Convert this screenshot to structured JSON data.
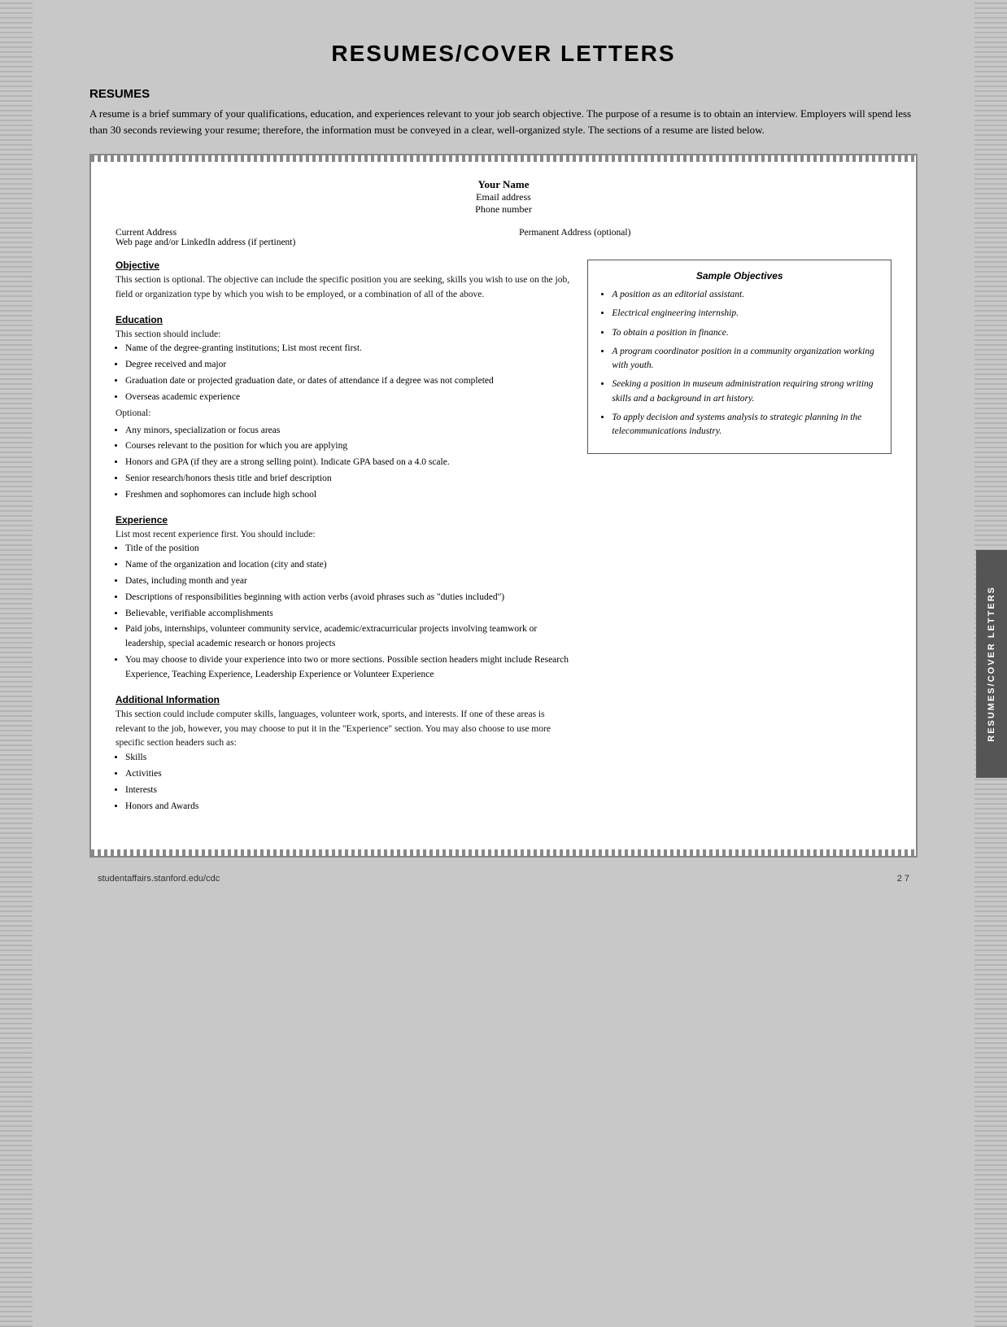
{
  "page": {
    "title": "RESUMES/COVER LETTERS",
    "background_color": "#c8c8c8"
  },
  "resumes_section": {
    "heading": "RESUMES",
    "intro": "A resume is a brief summary of your qualifications, education, and experiences relevant to your job search objective. The purpose of a resume is to obtain an interview. Employers will spend less than 30 seconds reviewing your resume; therefore, the information must be conveyed in a clear, well-organized style. The sections of a resume are listed below."
  },
  "resume_document": {
    "header": {
      "name": "Your Name",
      "email": "Email address",
      "phone": "Phone number"
    },
    "address": {
      "current_label": "Current Address",
      "current_sub": "Web page and/or LinkedIn address (if pertinent)",
      "permanent_label": "Permanent Address (optional)"
    },
    "objective_section": {
      "title": "Objective",
      "text": "This section is optional. The objective can include the specific position you are seeking, skills you wish to use on the job, field or organization type by which you wish to be employed, or a combination of all of the above."
    },
    "education_section": {
      "title": "Education",
      "intro": "This section should include:",
      "items": [
        "Name of the degree-granting institutions; List most recent first.",
        "Degree received and major",
        "Graduation date or projected graduation date, or dates of attendance if a degree was not completed",
        "Overseas academic experience"
      ],
      "optional_label": "Optional:",
      "optional_items": [
        "Any minors, specialization or focus areas",
        "Courses relevant to the position for which you are applying",
        "Honors and GPA (if they are a strong selling point). Indicate GPA based on a 4.0 scale.",
        "Senior research/honors thesis title and brief description",
        "Freshmen and sophomores can include high school"
      ]
    },
    "experience_section": {
      "title": "Experience",
      "intro": "List most recent experience first. You should include:",
      "items": [
        "Title of the position",
        "Name of the organization and location (city and state)",
        "Dates, including month and year",
        "Descriptions of responsibilities beginning with action verbs (avoid phrases such as \"duties included\")",
        "Believable, verifiable accomplishments",
        "Paid jobs, internships, volunteer community service, academic/extracurricular projects involving teamwork or leadership, special academic research or honors projects",
        "You may choose to divide your experience into two or more sections. Possible section headers might include Research Experience, Teaching Experience, Leadership Experience or Volunteer Experience"
      ]
    },
    "additional_info_section": {
      "title": "Additional Information",
      "text": "This section could include computer skills, languages, volunteer work, sports, and interests. If one of these areas is relevant to the job, however, you may choose to put it in the \"Experience\" section. You may also choose to use more specific section headers such as:",
      "items": [
        "Skills",
        "Activities",
        "Interests",
        "Honors and Awards"
      ]
    }
  },
  "sample_objectives": {
    "title": "Sample Objectives",
    "items": [
      "A position as an editorial assistant.",
      "Electrical engineering internship.",
      "To obtain a position in finance.",
      "A program coordinator position in a community organization working with youth.",
      "Seeking a position in museum administration requiring strong writing skills and a background in art history.",
      "To apply decision and systems analysis to strategic planning in the telecommunications industry."
    ]
  },
  "vertical_tab": {
    "text": "RESUMES/COVER LETTERS"
  },
  "footer": {
    "url": "studentaffairs.stanford.edu/cdc",
    "page": "2 7"
  }
}
